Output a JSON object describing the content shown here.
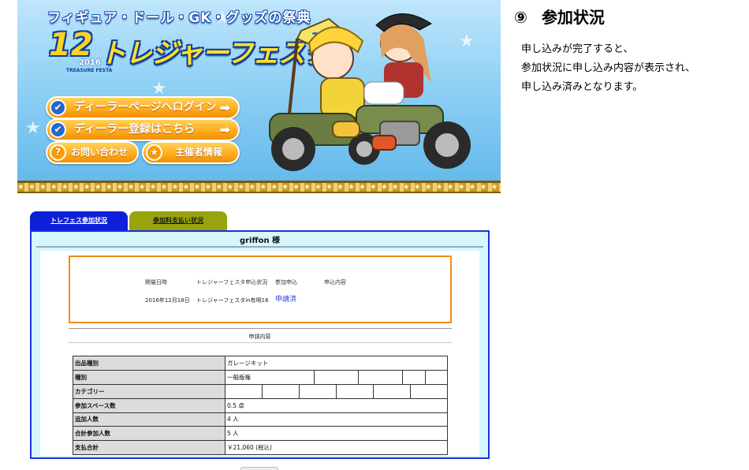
{
  "banner": {
    "tagline": "フィギュア・ドール・GK・グッズの祭典",
    "logo_mark": "12",
    "logo_year": "2016",
    "logo_sub": "TREASURE FESTA",
    "logo_title": "トレジャーフェスタ",
    "buttons": {
      "dealer_login": "ディーラーページへログイン",
      "dealer_register": "ディーラー登録はこちら",
      "contact": "お問い合わせ",
      "organizer": "主催者情報"
    },
    "border_pattern": "★★★★★★★★★★★★★★★★★★★★★★★★★★★★★★★★★★★★★★★★★★★★★★★"
  },
  "step": {
    "number": "⑨",
    "title": "参加状況",
    "description": [
      "申し込みが完了すると、",
      "参加状況に申し込み内容が表示され、",
      "申し込み済みとなります。"
    ]
  },
  "tabs": {
    "status": "トレフェス参加状況",
    "payment": "参加料支払い状況"
  },
  "panel": {
    "title": "griffon 様",
    "summary": {
      "headers": [
        "開催日時",
        "トレジャーフェスタ申込状況",
        "参加申込",
        "申込内容"
      ],
      "date": "2016年12月18日",
      "festa": "トレジャーフェスタin有明16",
      "status": "申請済"
    },
    "details_heading": "申請内容",
    "details": [
      {
        "label": "出品種別",
        "value": "ガレージキット"
      },
      {
        "label": "種別",
        "value": "一般版権"
      },
      {
        "label": "カテゴリー",
        "value": ""
      },
      {
        "label": "参加スペース数",
        "value": "0.5  卓"
      },
      {
        "label": "追加人数",
        "value": "4  人"
      },
      {
        "label": "合計参加人数",
        "value": "5  人"
      },
      {
        "label": "支払合計",
        "value": "￥21,060  (税込)"
      }
    ]
  },
  "colors": {
    "tab_active": "#0e1fd9",
    "tab_inactive": "#97a40d",
    "panel_border": "#1f2fe0",
    "panel_bg": "#d6f7fb",
    "summary_border": "#f08c1a",
    "status_text": "#2a3ee0"
  }
}
